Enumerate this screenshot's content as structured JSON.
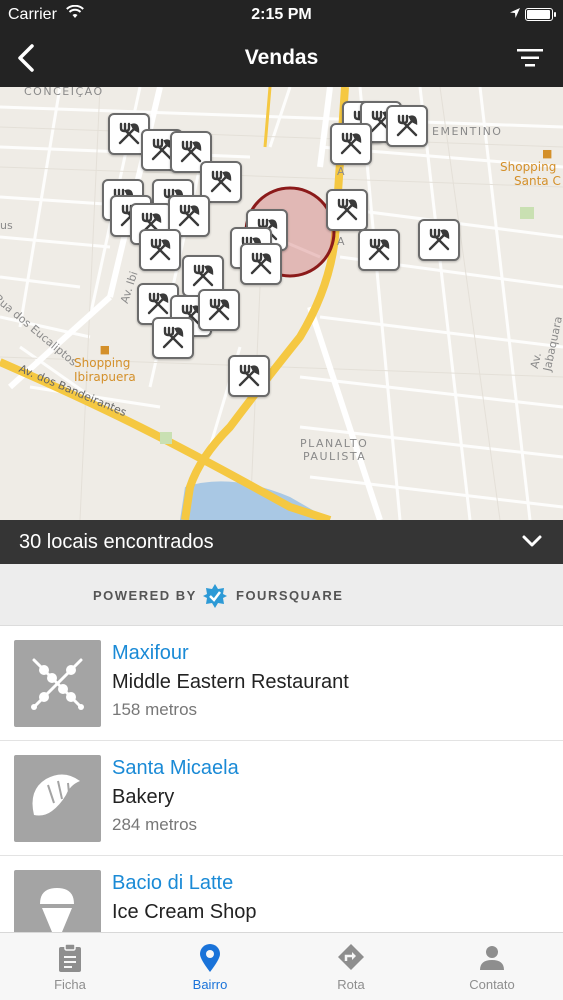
{
  "status_bar": {
    "carrier": "Carrier",
    "time": "2:15 PM"
  },
  "nav": {
    "title": "Vendas",
    "back_icon": "chevron-left-icon",
    "filter_icon": "filter-icon"
  },
  "map": {
    "labels": {
      "conceicao": "CONCEIÇÃO",
      "clementino": "EMENTINO",
      "planalto": "PLANALTO",
      "paulista": "PAULISTA",
      "eucaliptos": "Rua dos Eucaliptos",
      "bandeirantes": "Av. dos Bandeirantes",
      "jabaquara": "Av. Jabaquara",
      "ibirapuera_av": "Av. Ibi",
      "us": "us",
      "road_a": "A",
      "road_a2": "A"
    },
    "shopping_ibirapuera": [
      "Shopping",
      "Ibirapuera"
    ],
    "shopping_santa_cruz": [
      "Shopping",
      "Santa C"
    ],
    "found_text": "30 locais encontrados"
  },
  "powered": {
    "left": "POWERED BY",
    "right": "FOURSQUARE"
  },
  "venues": [
    {
      "name": "Maxifour",
      "category": "Middle Eastern Restaurant",
      "distance": "158 metros",
      "icon": "kebab-icon"
    },
    {
      "name": "Santa Micaela",
      "category": "Bakery",
      "distance": "284 metros",
      "icon": "croissant-icon"
    },
    {
      "name": "Bacio di Latte",
      "category": "Ice Cream Shop",
      "distance": "",
      "icon": "ice-cream-icon"
    }
  ],
  "tabs": [
    {
      "label": "Ficha",
      "icon": "clipboard-icon",
      "active": false
    },
    {
      "label": "Bairro",
      "icon": "map-pin-icon",
      "active": true
    },
    {
      "label": "Rota",
      "icon": "route-icon",
      "active": false
    },
    {
      "label": "Contato",
      "icon": "person-icon",
      "active": false
    }
  ],
  "colors": {
    "accent": "#1a73d9",
    "link": "#1a8ad6",
    "road": "#f5c842",
    "radius": "#8b1a1a"
  }
}
